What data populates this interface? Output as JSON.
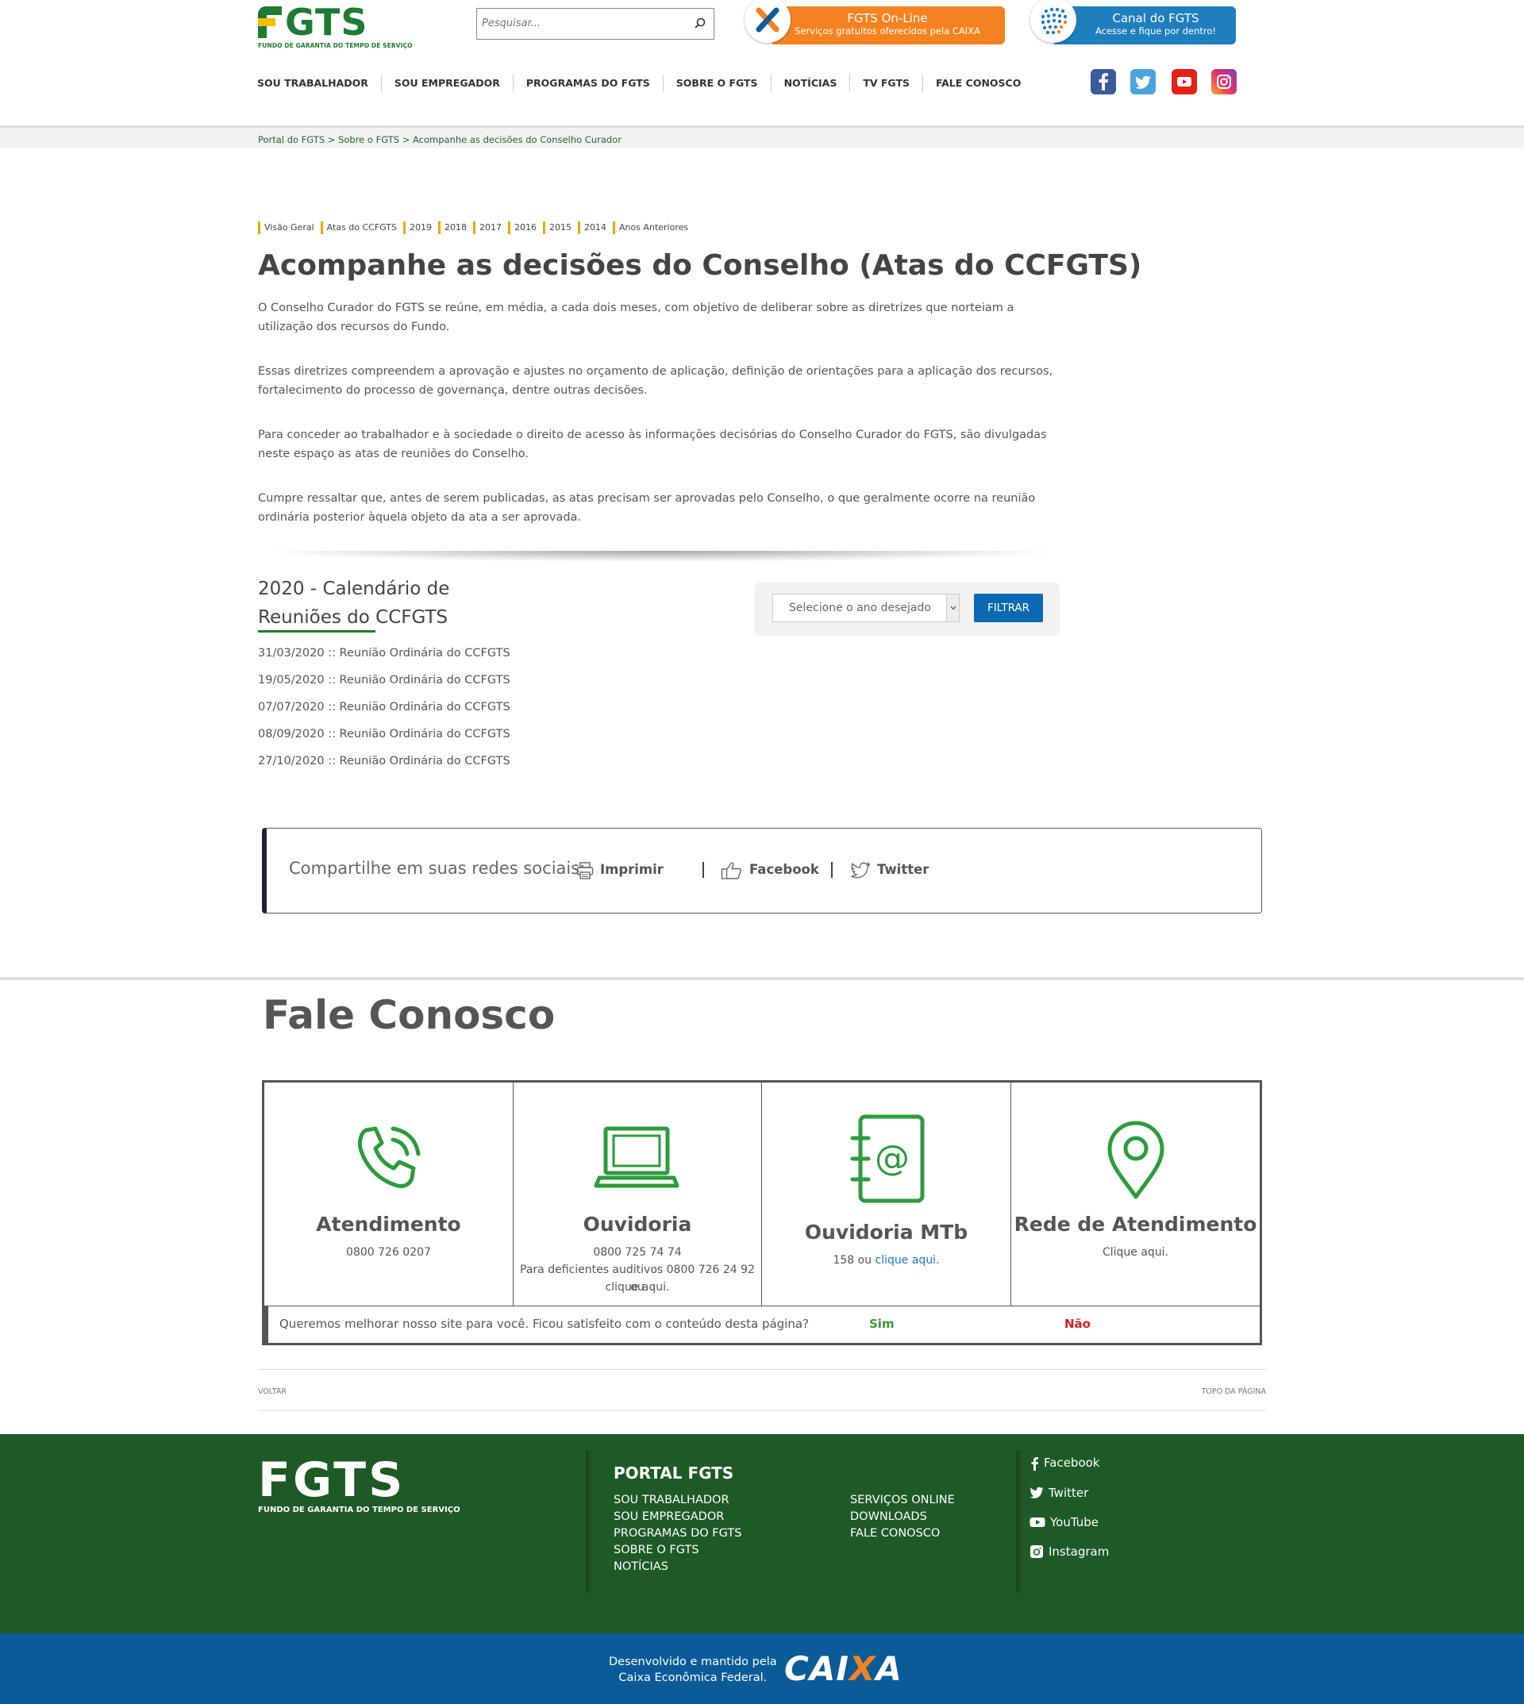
{
  "header": {
    "logo_word": "GTS",
    "logo_sub": "FUNDO DE GARANTIA DO TEMPO DE SERVIÇO",
    "search_placeholder": "Pesquisar...",
    "promo_fgts": {
      "title": "FGTS On-Line",
      "sub": "Serviços gratuitos oferecidos pela CAIXA"
    },
    "promo_canal": {
      "title": "Canal do FGTS",
      "sub": "Acesse e fique por dentro!"
    },
    "nav": [
      "SOU TRABALHADOR",
      "SOU EMPREGADOR",
      "PROGRAMAS DO FGTS",
      "SOBRE O FGTS",
      "NOTÍCIAS",
      "TV FGTS",
      "FALE CONOSCO"
    ],
    "social_icons": [
      "facebook-icon",
      "twitter-icon",
      "youtube-icon",
      "instagram-icon"
    ],
    "breadcrumb": "Portal do FGTS > Sobre o FGTS > Acompanhe as decisões do Conselho Curador"
  },
  "subnav": [
    "Visão Geral",
    "Atas do CCFGTS",
    "2019",
    "2018",
    "2017",
    "2016",
    "2015",
    "2014",
    "Anos Anteriores"
  ],
  "content": {
    "title": "Acompanhe as decisões do Conselho (Atas do CCFGTS)",
    "paragraphs": [
      "O Conselho Curador do FGTS se reúne, em média, a cada dois meses, com objetivo de deliberar sobre as diretrizes que norteiam a utilização dos recursos do Fundo.",
      "Essas diretrizes compreendem a aprovação e ajustes no orçamento de aplicação, definição de orientações para a aplicação dos recursos, fortalecimento do processo de governança, dentre outras decisões.",
      "Para conceder ao trabalhador e à sociedade o direito de acesso às informações decisórias do Conselho Curador do FGTS, são divulgadas neste espaço as atas de reuniões do Conselho.",
      "Cumpre ressaltar que, antes de serem publicadas, as atas precisam ser aprovadas pelo Conselho, o que geralmente ocorre na reunião ordinária posterior àquela objeto da ata a ser aprovada."
    ],
    "calendar_title_line1": "2020 - Calendário de",
    "calendar_title_line2": "Reuniões do CCFGTS",
    "meetings": [
      "31/03/2020 :: Reunião Ordinária do CCFGTS",
      "19/05/2020 :: Reunião Ordinária do CCFGTS",
      "07/07/2020 :: Reunião Ordinária do CCFGTS",
      "08/09/2020 :: Reunião Ordinária do CCFGTS",
      "27/10/2020 :: Reunião Ordinária do CCFGTS"
    ],
    "filter_select": "Selecione o ano desejado",
    "filter_button": "FILTRAR"
  },
  "share": {
    "label": "Compartilhe em suas redes sociais:",
    "print": "Imprimir",
    "facebook": "Facebook",
    "twitter": "Twitter"
  },
  "fale_conosco": {
    "title": "Fale Conosco",
    "atendimento": {
      "name": "Atendimento",
      "phone": "0800 726 0207"
    },
    "ouvidoria": {
      "name": "Ouvidoria",
      "phone": "0800 725 74 74",
      "deaf": "Para deficientes auditivos 0800 726 24 92 ou",
      "link": "clique aqui."
    },
    "ouvidoria_mtb": {
      "name": "Ouvidoria MTb",
      "phone": "158 ou",
      "link": "clique aqui."
    },
    "rede": {
      "name": "Rede de Atendimento",
      "link": "Clique aqui."
    },
    "feedback_q": "Queremos melhorar nosso site para você. Ficou satisfeito com o conteúdo desta página?",
    "yes": "Sim",
    "no": "Não"
  },
  "bottom_links": {
    "back": "VOLTAR",
    "top": "TOPO DA PÁGINA"
  },
  "footer": {
    "logo_word": "FGTS",
    "logo_sub": "FUNDO DE GARANTIA DO TEMPO DE SERVIÇO",
    "portal_title": "PORTAL FGTS",
    "col1": [
      "SOU TRABALHADOR",
      "SOU EMPREGADOR",
      "PROGRAMAS DO FGTS",
      "SOBRE O FGTS",
      "NOTÍCIAS"
    ],
    "col2": [
      "SERVIÇOS ONLINE",
      "DOWNLOADS",
      "FALE CONOSCO"
    ],
    "social": [
      "Facebook",
      "Twitter",
      "YouTube",
      "Instagram"
    ],
    "dev_line1": "Desenvolvido e mantido pela",
    "dev_line2": "Caixa Econômica Federal.",
    "caixa_pre": "CAI",
    "caixa_x": "X",
    "caixa_post": "A"
  },
  "colors": {
    "fgts_green": "#1f7a34",
    "footer_green": "#1e5a25",
    "caixa_blue": "#0b5b99",
    "promo_orange": "#f58220",
    "promo_blue": "#1f7fbe"
  }
}
